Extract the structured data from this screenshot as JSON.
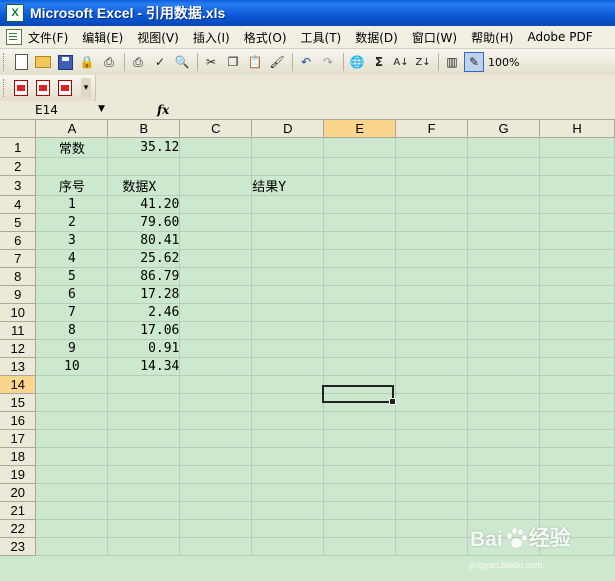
{
  "window": {
    "title": "Microsoft Excel - 引用数据.xls",
    "icon": "excel-icon"
  },
  "menu": {
    "items": [
      "文件(F)",
      "编辑(E)",
      "视图(V)",
      "插入(I)",
      "格式(O)",
      "工具(T)",
      "数据(D)",
      "窗口(W)",
      "帮助(H)",
      "Adobe PDF"
    ]
  },
  "toolbar": {
    "zoom": "100%",
    "icons": [
      "new-icon",
      "open-icon",
      "save-icon",
      "permission-icon",
      "print-icon",
      "print-preview-icon",
      "spelling-icon",
      "research-icon",
      "cut-icon",
      "copy-icon",
      "paste-icon",
      "format-painter-icon",
      "undo-icon",
      "redo-icon",
      "hyperlink-icon",
      "autosum-icon",
      "sort-asc-icon",
      "sort-desc-icon",
      "chart-wizard-icon",
      "drawing-icon"
    ]
  },
  "pdf_toolbar": {
    "icons": [
      "convert-to-pdf-icon",
      "convert-and-email-icon",
      "convert-and-review-icon"
    ]
  },
  "formula_bar": {
    "name_box": "E14",
    "fx_label": "fx",
    "formula": ""
  },
  "sheet": {
    "columns": [
      "A",
      "B",
      "C",
      "D",
      "E",
      "F",
      "G",
      "H"
    ],
    "selected_column": "E",
    "selected_row": 14,
    "rows": [
      {
        "n": "1",
        "A": "常数",
        "B": "35.12",
        "C": "",
        "D": ""
      },
      {
        "n": "2",
        "A": "",
        "B": "",
        "C": "",
        "D": ""
      },
      {
        "n": "3",
        "A": "序号",
        "B": "数据X",
        "C": "",
        "D": "结果Y"
      },
      {
        "n": "4",
        "A": "1",
        "B": "41.20",
        "C": "",
        "D": ""
      },
      {
        "n": "5",
        "A": "2",
        "B": "79.60",
        "C": "",
        "D": ""
      },
      {
        "n": "6",
        "A": "3",
        "B": "80.41",
        "C": "",
        "D": ""
      },
      {
        "n": "7",
        "A": "4",
        "B": "25.62",
        "C": "",
        "D": ""
      },
      {
        "n": "8",
        "A": "5",
        "B": "86.79",
        "C": "",
        "D": ""
      },
      {
        "n": "9",
        "A": "6",
        "B": "17.28",
        "C": "",
        "D": ""
      },
      {
        "n": "10",
        "A": "7",
        "B": "2.46",
        "C": "",
        "D": ""
      },
      {
        "n": "11",
        "A": "8",
        "B": "17.06",
        "C": "",
        "D": ""
      },
      {
        "n": "12",
        "A": "9",
        "B": "0.91",
        "C": "",
        "D": ""
      },
      {
        "n": "13",
        "A": "10",
        "B": "14.34",
        "C": "",
        "D": ""
      },
      {
        "n": "14",
        "A": "",
        "B": "",
        "C": "",
        "D": ""
      },
      {
        "n": "15",
        "A": "",
        "B": "",
        "C": "",
        "D": ""
      },
      {
        "n": "16",
        "A": "",
        "B": "",
        "C": "",
        "D": ""
      },
      {
        "n": "17",
        "A": "",
        "B": "",
        "C": "",
        "D": ""
      },
      {
        "n": "18",
        "A": "",
        "B": "",
        "C": "",
        "D": ""
      },
      {
        "n": "19",
        "A": "",
        "B": "",
        "C": "",
        "D": ""
      },
      {
        "n": "20",
        "A": "",
        "B": "",
        "C": "",
        "D": ""
      },
      {
        "n": "21",
        "A": "",
        "B": "",
        "C": "",
        "D": ""
      },
      {
        "n": "22",
        "A": "",
        "B": "",
        "C": "",
        "D": ""
      },
      {
        "n": "23",
        "A": "",
        "B": "",
        "C": "",
        "D": ""
      }
    ]
  },
  "watermark": {
    "text": "Bai",
    "text2": "经验",
    "sub": "jingyan.baidu.com"
  }
}
